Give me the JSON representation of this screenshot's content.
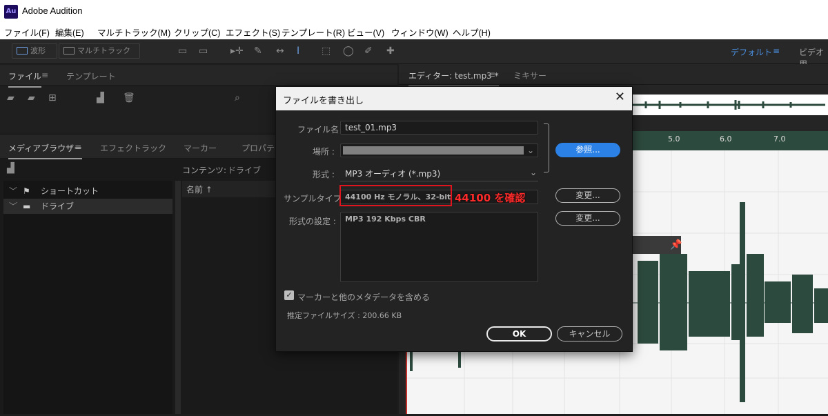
{
  "app": {
    "logo": "Au",
    "title": "Adobe Audition"
  },
  "menu": [
    "ファイル(F)",
    "編集(E)",
    "マルチトラック(M)",
    "クリップ(C)",
    "エフェクト(S)",
    "テンプレート(R)",
    "ビュー(V)",
    "ウィンドウ(W)",
    "ヘルプ(H)"
  ],
  "toolbar": {
    "waveform": "波形",
    "multitrack": "マルチトラック",
    "workspace_default": "デフォルト",
    "workspace_video": "ビデオ用"
  },
  "files_panel": {
    "tabs": [
      "ファイル",
      "テンプレート"
    ]
  },
  "media_panel": {
    "tabs": [
      "メディアブラウザー",
      "エフェクトラック",
      "マーカー",
      "プロパティ"
    ],
    "contents_label": "コンテンツ:",
    "contents_value": "ドライブ",
    "name_column": "名前 ↑",
    "tree": [
      {
        "label": "ショートカット"
      },
      {
        "label": "ドライブ"
      }
    ]
  },
  "editor": {
    "tabs": [
      "エディター: test.mp3 *",
      "ミキサー"
    ],
    "ruler": [
      "5.0",
      "6.0",
      "7.0"
    ]
  },
  "dialog": {
    "title": "ファイルを書き出し",
    "filename_label": "ファイル名 :",
    "filename": "test_01.mp3",
    "location_label": "場所 :",
    "format_label": "形式 :",
    "format": "MP3 オーディオ (*.mp3)",
    "browse": "参照...",
    "sample_type_label": "サンプルタイプ :",
    "sample_type": "44100 Hz モノラル、32-bit",
    "annotation": "44100 を確認",
    "change1": "変更...",
    "format_settings_label": "形式の設定 :",
    "format_settings": "MP3 192 Kbps CBR",
    "change2": "変更...",
    "include_markers": "マーカーと他のメタデータを含める",
    "estimated_size": "推定ファイルサイズ : 200.66 KB",
    "ok": "OK",
    "cancel": "キャンセル"
  },
  "colors": {
    "accent_blue": "#2b81e5",
    "waveform": "#2d4a3e",
    "highlight_red": "#e0141c"
  }
}
